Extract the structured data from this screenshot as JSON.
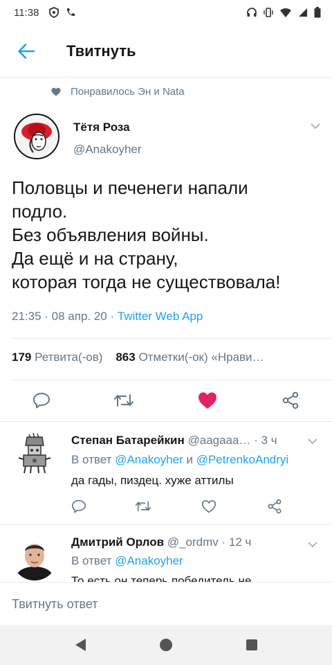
{
  "status_bar": {
    "time": "11:38"
  },
  "header": {
    "title": "Твитнуть"
  },
  "social_context": {
    "text": "Понравилось Эн и Nata"
  },
  "tweet": {
    "author_name": "Тётя Роза",
    "author_handle": "@Anakoyher",
    "text_lines": [
      "Половцы и печенеги напали",
      "подло.",
      "Без объявления войны.",
      "Да ещё и на страну,",
      "которая тогда не существовала!"
    ],
    "time": "21:35",
    "date": "08 апр. 20",
    "source_app": "Twitter Web App",
    "retweets_count": "179",
    "retweets_label": "Ретвита(-ов)",
    "likes_count": "863",
    "likes_label": "Отметки(-ок) «Нрави…",
    "liked": true
  },
  "replies": [
    {
      "name": "Степан Батарейкин",
      "handle": "@aagaaa…",
      "time": "· 3 ч",
      "reply_prefix": "В ответ",
      "reply_to_1": "@Anakoyher",
      "reply_conj": "и",
      "reply_to_2": "@PetrenkoAndryi",
      "text": "да гады, пиздец. хуже аттилы"
    },
    {
      "name": "Дмитрий Орлов",
      "handle": "@_ordmv",
      "time": "· 12 ч",
      "reply_prefix": "В ответ",
      "reply_to_1": "@Anakoyher",
      "text": "То есть он теперь победитель не"
    }
  ],
  "composer": {
    "placeholder": "Твитнуть ответ"
  },
  "colors": {
    "accent": "#1da1f2",
    "like": "#e0245e",
    "secondary_text": "#657786"
  }
}
